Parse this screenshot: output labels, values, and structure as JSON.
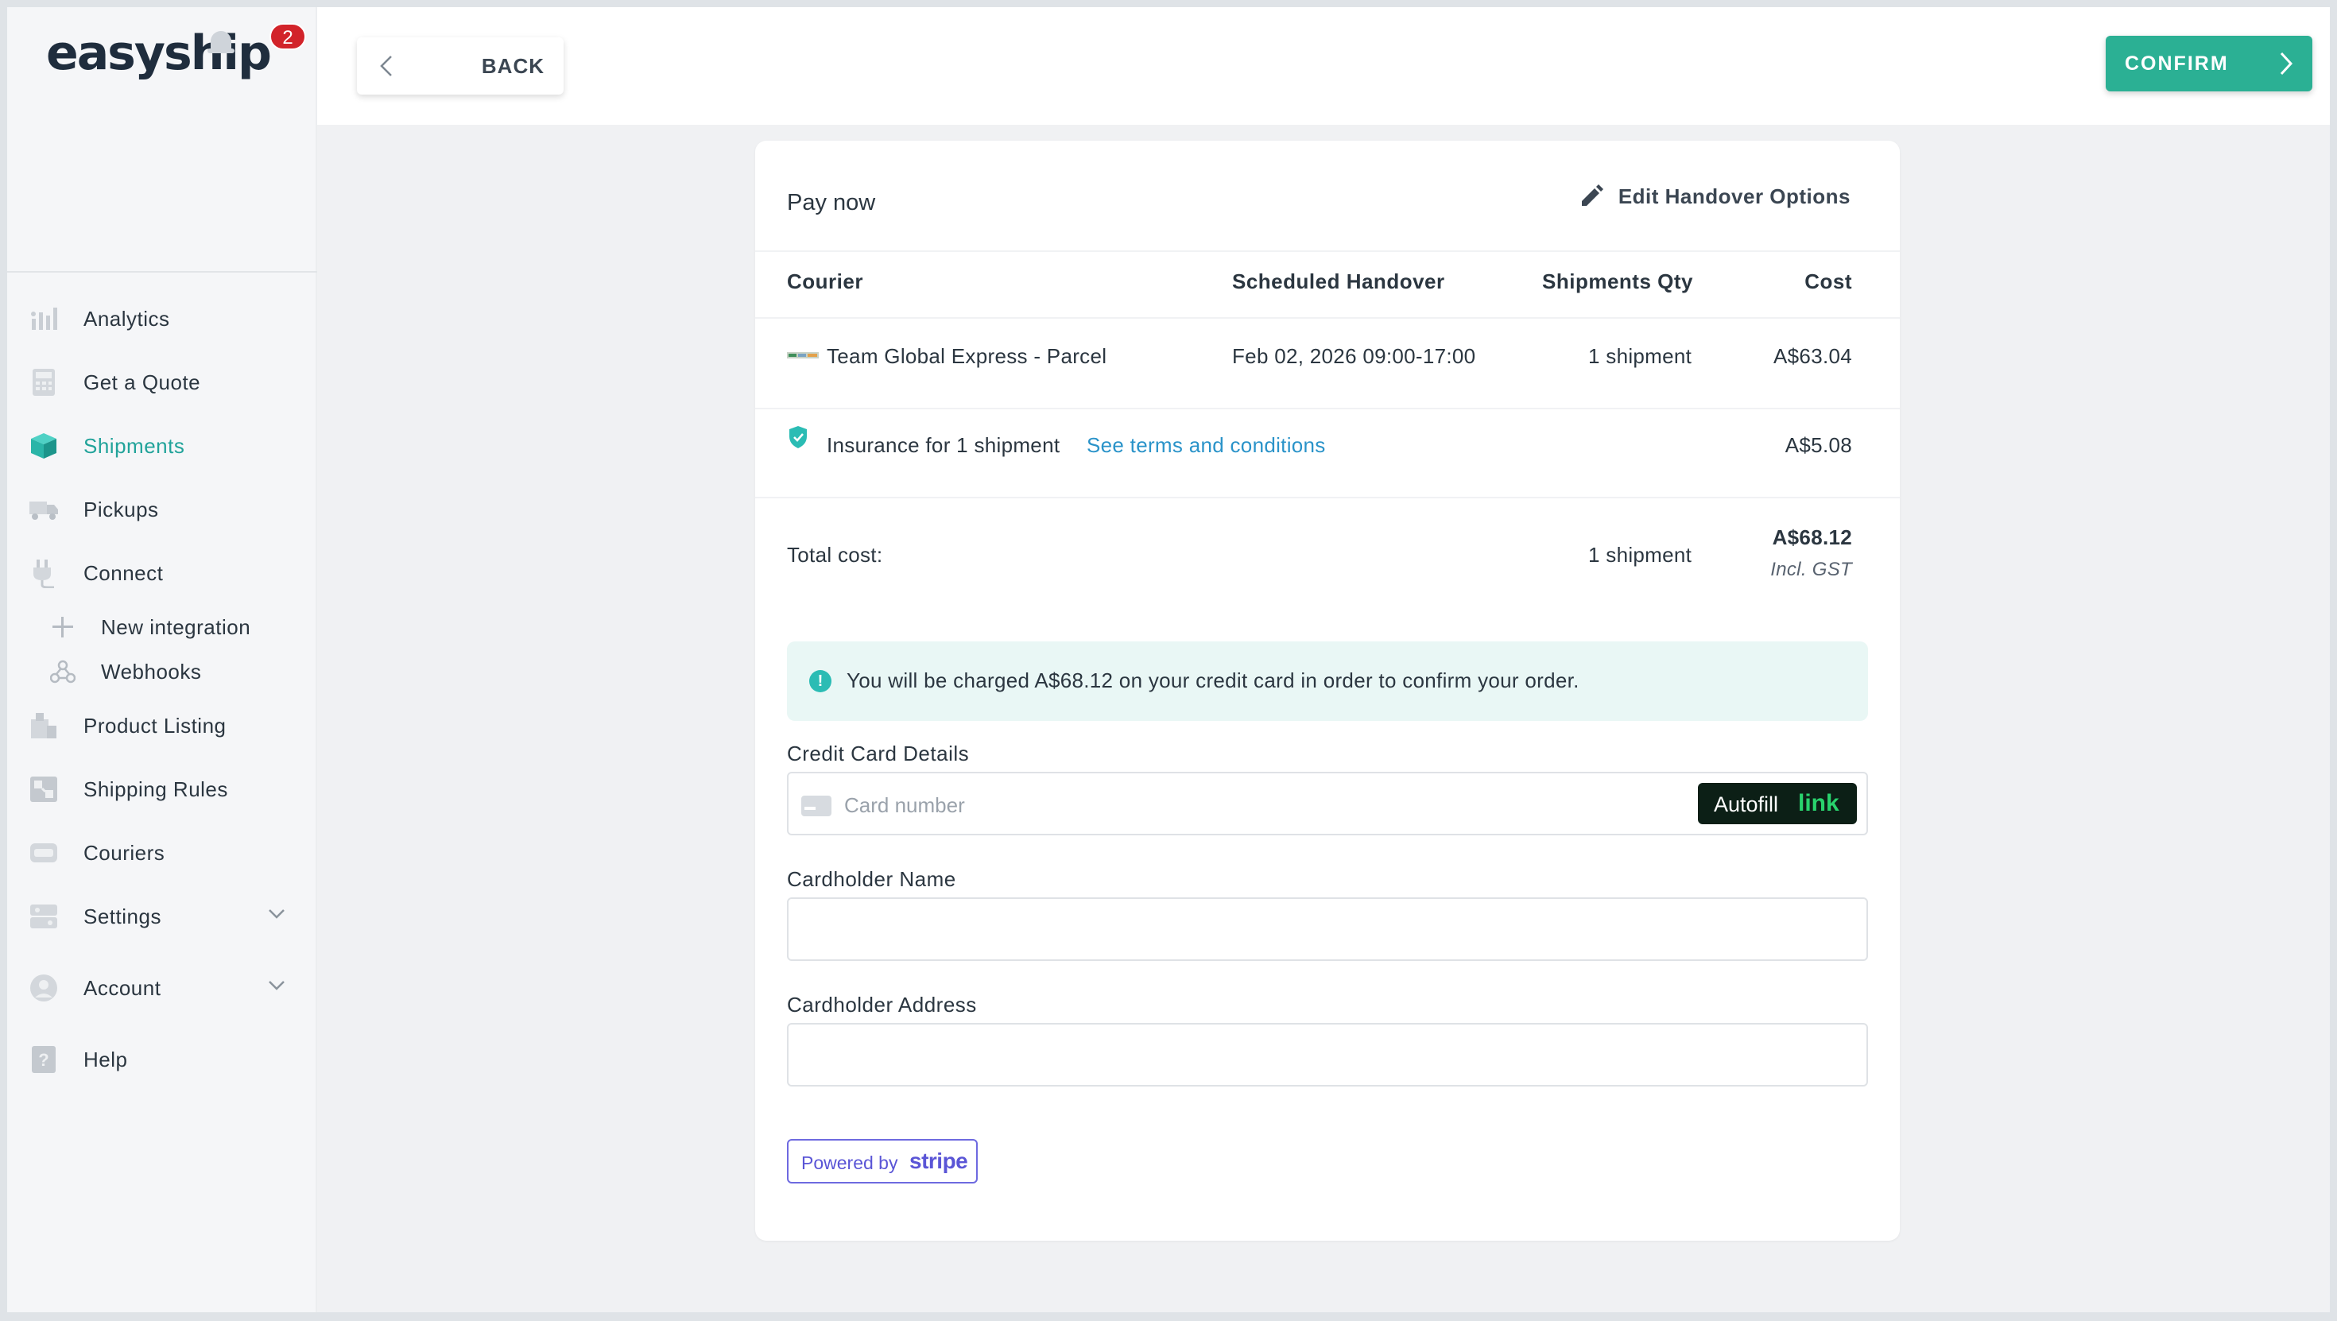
{
  "brand": {
    "logo_text": "easyship",
    "notification_count": "2"
  },
  "sidebar": {
    "items": [
      {
        "label": "Analytics",
        "icon": "analytics-icon"
      },
      {
        "label": "Get a Quote",
        "icon": "calculator-icon"
      },
      {
        "label": "Shipments",
        "icon": "box-icon",
        "active": true
      },
      {
        "label": "Pickups",
        "icon": "truck-icon"
      },
      {
        "label": "Connect",
        "icon": "plug-icon"
      }
    ],
    "sub_items": [
      {
        "label": "New integration",
        "icon": "plus-icon"
      },
      {
        "label": "Webhooks",
        "icon": "webhook-icon"
      }
    ],
    "items_2": [
      {
        "label": "Product Listing",
        "icon": "product-icon"
      },
      {
        "label": "Shipping Rules",
        "icon": "rules-icon"
      },
      {
        "label": "Couriers",
        "icon": "courier-icon"
      },
      {
        "label": "Settings",
        "icon": "settings-icon",
        "expandable": true
      },
      {
        "label": "Account",
        "icon": "account-icon",
        "expandable": true
      },
      {
        "label": "Help",
        "icon": "help-icon"
      }
    ]
  },
  "topbar": {
    "back_label": "BACK",
    "confirm_label": "CONFIRM"
  },
  "payment": {
    "title": "Pay now",
    "edit_label": "Edit Handover Options",
    "columns": {
      "courier": "Courier",
      "handover": "Scheduled Handover",
      "qty": "Shipments Qty",
      "cost": "Cost"
    },
    "shipment_row": {
      "courier": "Team Global Express - Parcel",
      "handover": "Feb 02, 2026 09:00-17:00",
      "qty": "1 shipment",
      "cost": "A$63.04"
    },
    "insurance_row": {
      "label": "Insurance for 1 shipment",
      "link": "See terms and conditions",
      "cost": "A$5.08"
    },
    "total_row": {
      "label": "Total cost:",
      "qty": "1 shipment",
      "cost": "A$68.12",
      "tax_note": "Incl. GST"
    },
    "notice": "You will be charged A$68.12 on your credit card in order to confirm your order.",
    "card_details_label": "Credit Card Details",
    "card_placeholder": "Card number",
    "autofill_text": "Autofill",
    "autofill_link": "link",
    "cardholder_name_label": "Cardholder Name",
    "cardholder_address_label": "Cardholder Address",
    "powered_by": "Powered by",
    "powered_brand": "stripe"
  },
  "colors": {
    "accent": "#21a39a",
    "confirm": "#2bb094",
    "link": "#2a93c9",
    "stripe": "#5a55d6"
  }
}
